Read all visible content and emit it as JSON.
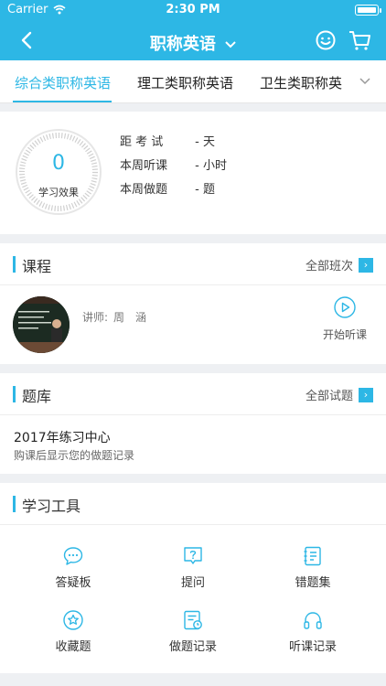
{
  "status": {
    "carrier": "Carrier",
    "time": "2:30 PM"
  },
  "nav": {
    "title": "职称英语",
    "back_icon": "chevron-left-icon",
    "emoji_icon": "smile-icon",
    "cart_icon": "cart-icon"
  },
  "tabs": [
    {
      "label": "综合类职称英语"
    },
    {
      "label": "理工类职称英语"
    },
    {
      "label": "卫生类职称英"
    }
  ],
  "stats": {
    "effect_value": "0",
    "effect_label": "学习效果",
    "rows": [
      {
        "label": "距 考 试",
        "value": "- 天"
      },
      {
        "label": "本周听课",
        "value": "- 小时"
      },
      {
        "label": "本周做题",
        "value": "- 题"
      }
    ]
  },
  "course": {
    "title": "课程",
    "more": "全部班次",
    "teacher_label": "讲师:",
    "teacher_name": "周　涵",
    "play_label": "开始听课"
  },
  "bank": {
    "title": "题库",
    "more": "全部试题",
    "item_title": "2017年练习中心",
    "item_sub": "购课后显示您的做题记录"
  },
  "tools": {
    "title": "学习工具",
    "items": [
      {
        "label": "答疑板",
        "icon": "chat-bubble-icon"
      },
      {
        "label": "提问",
        "icon": "question-icon"
      },
      {
        "label": "错题集",
        "icon": "notebook-icon"
      },
      {
        "label": "收藏题",
        "icon": "star-icon"
      },
      {
        "label": "做题记录",
        "icon": "record-icon"
      },
      {
        "label": "听课记录",
        "icon": "headphones-icon"
      }
    ]
  },
  "colors": {
    "accent": "#2db7e5",
    "background": "#eef0f3"
  }
}
